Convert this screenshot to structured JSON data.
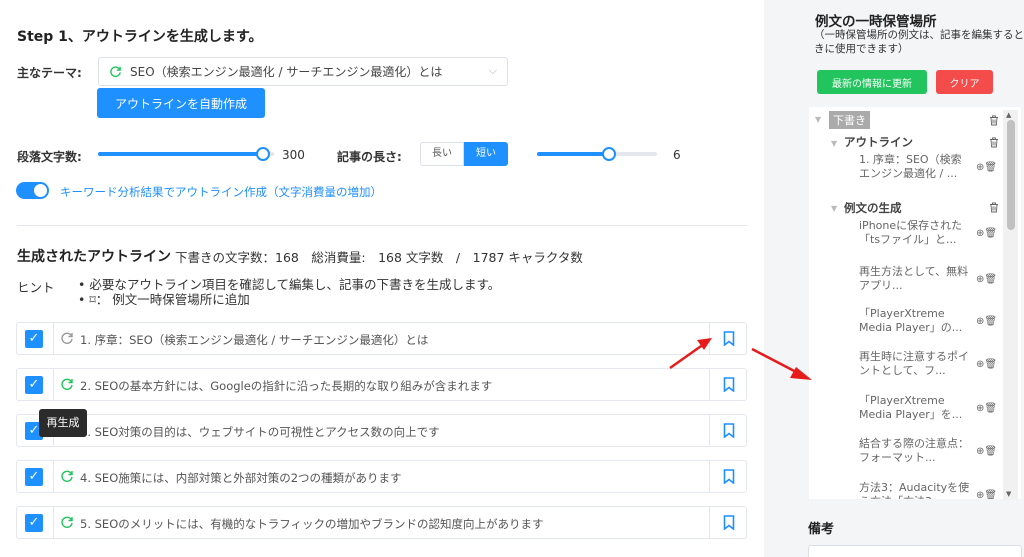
{
  "main": {
    "step_title": "Step 1、アウトラインを生成します。",
    "theme_label": "主なテーマ:",
    "theme_value": "SEO（検索エンジン最適化 / サーチエンジン最適化）とは",
    "auto_button": "アウトラインを自動作成",
    "paragraph_label": "段落文字数:",
    "paragraph_value": "300",
    "paragraph_level": 0.94,
    "length_label": "記事の長さ:",
    "length_options": [
      "長い",
      "短い"
    ],
    "length_selected": "短い",
    "count_value": "6",
    "count_level": 0.6,
    "keyword_toggle_label": "キーワード分析結果でアウトライン作成（文字消費量の増加）",
    "keyword_toggle_on": true,
    "generated_title": "生成されたアウトライン",
    "generated_stats": "下書きの文字数：168　総消費量:　168 文字数　/　1787 キャラクタ数",
    "hint_label": "ヒント",
    "hints": [
      "必要なアウトライン項目を確認して編集し、記事の下書きを生成します。",
      "⌑：  例文一時保管場所に追加"
    ],
    "tooltip": "再生成",
    "outline_items": [
      "1. 序章：SEO（検索エンジン最適化 / サーチエンジン最適化）とは",
      "2. SEOの基本方針には、Googleの指針に沿った長期的な取り組みが含まれます",
      "3. SEO対策の目的は、ウェブサイトの可視性とアクセス数の向上です",
      "4. SEO施策には、内部対策と外部対策の2つの種類があります",
      "5. SEOのメリットには、有機的なトラフィックの増加やブランドの認知度向上があります"
    ]
  },
  "side": {
    "title": "例文の一時保管場所",
    "description": "（一時保管場所の例文は、記事を編集するときに使用できます）",
    "refresh_button": "最新の情報に更新",
    "clear_button": "クリア",
    "tree": {
      "root": "下書き",
      "outline_node": "アウトライン",
      "outline_items": [
        "1. 序章：SEO（検索エンジン最適化 / ..."
      ],
      "examples_node": "例文の生成",
      "example_items": [
        "iPhoneに保存された「tsファイル」と...",
        "再生方法として、無料アプリ...",
        "「PlayerXtreme Media Player」の...",
        "再生時に注意するポイントとして、フ...",
        "「PlayerXtreme Media Player」を...",
        "結合する際の注意点：フォーマット...",
        "方法3：Audacityを使う方法「方法3」"
      ]
    },
    "memo_label": "備考"
  },
  "colors": {
    "accent": "#1e90ff",
    "refresh": "#21c45d",
    "clear": "#f44b4b",
    "arrow": "#e81b1b"
  },
  "icons": {
    "check": "check-icon",
    "refresh": "refresh-icon",
    "bookmark": "bookmark-icon",
    "trash": "trash-icon",
    "add": "add-icon"
  }
}
